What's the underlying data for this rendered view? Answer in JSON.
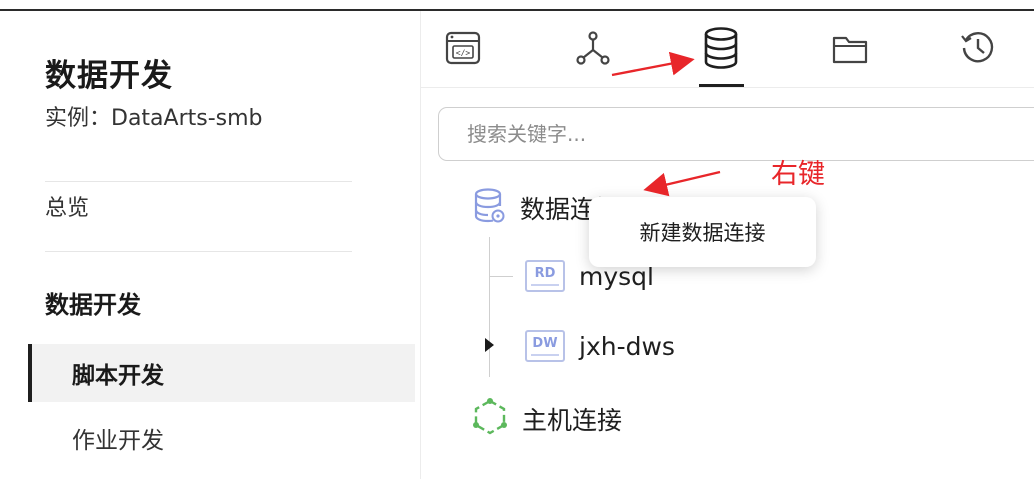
{
  "sidebar": {
    "app_title": "数据开发",
    "instance": "实例：DataArts-smb",
    "overview": "总览",
    "section_title": "数据开发",
    "items": [
      {
        "label": "脚本开发",
        "active": true
      },
      {
        "label": "作业开发",
        "active": false
      }
    ]
  },
  "toolbar": {
    "icons": [
      "script-icon",
      "flow-icon",
      "database-icon",
      "folder-icon",
      "history-icon"
    ],
    "active": "database-icon"
  },
  "search": {
    "placeholder": "搜索关键字..."
  },
  "tree": {
    "data_connections": {
      "label": "数据连接"
    },
    "children": [
      {
        "badge": "RD",
        "label": "mysql"
      },
      {
        "badge": "DW",
        "label": "jxh-dws",
        "collapsed": true
      }
    ],
    "host_connections": {
      "label": "主机连接"
    }
  },
  "context_menu": {
    "items": [
      "新建数据连接"
    ]
  },
  "annotation": {
    "text": "右键",
    "color": "#e8262a"
  },
  "colors": {
    "accent_dark": "#1f1f1f",
    "db_icon": "#8a9be0",
    "host_icon": "#5cb85c"
  }
}
